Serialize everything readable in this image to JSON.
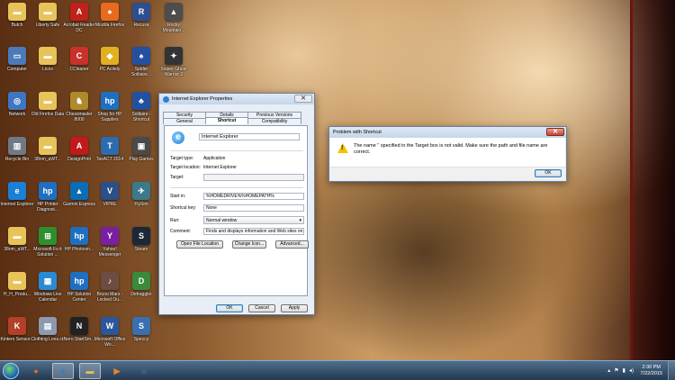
{
  "desktop_icons": [
    {
      "label": "Butch",
      "icon": "folder-icon",
      "color": "#e7c35a",
      "glyph": "▬"
    },
    {
      "label": "Liberty Safe",
      "icon": "folder-icon",
      "color": "#e7c35a",
      "glyph": "▬"
    },
    {
      "label": "Acrobat Reader DC",
      "icon": "acrobat-icon",
      "color": "#c0211b",
      "glyph": "A"
    },
    {
      "label": "Mozilla Firefox",
      "icon": "firefox-icon",
      "color": "#e86a1f",
      "glyph": "●"
    },
    {
      "label": "Recuva",
      "icon": "recuva-icon",
      "color": "#2d4f8f",
      "glyph": "R"
    },
    {
      "label": "Rocky Mountain...",
      "icon": "game-icon",
      "color": "#4d4d4d",
      "glyph": "▲"
    },
    {
      "label": "Computer",
      "icon": "computer-icon",
      "color": "#4a7bb8",
      "glyph": "▭"
    },
    {
      "label": "Licos",
      "icon": "folder-icon",
      "color": "#e7c35a",
      "glyph": "▬"
    },
    {
      "label": "CCleaner",
      "icon": "ccleaner-icon",
      "color": "#c8322a",
      "glyph": "C"
    },
    {
      "label": "PC Acitely",
      "icon": "app-icon",
      "color": "#e0b020",
      "glyph": "◆"
    },
    {
      "label": "Spider Solitaire...",
      "icon": "cards-icon",
      "color": "#2450a0",
      "glyph": "♠"
    },
    {
      "label": "Sniper Ghost Warrior 2",
      "icon": "game-icon",
      "color": "#333333",
      "glyph": "✦"
    },
    {
      "label": "Network",
      "icon": "network-icon",
      "color": "#3f76c2",
      "glyph": "◎"
    },
    {
      "label": "Old Firefox Data",
      "icon": "folder-icon",
      "color": "#e7c35a",
      "glyph": "▬"
    },
    {
      "label": "Chessmaster 8000",
      "icon": "chess-icon",
      "color": "#b08a2a",
      "glyph": "♞"
    },
    {
      "label": "Shop for HP Supplies",
      "icon": "hp-icon",
      "color": "#1f6fc1",
      "glyph": "hp"
    },
    {
      "label": "Solitaire - Shortcut",
      "icon": "cards-icon",
      "color": "#2450a0",
      "glyph": "♣"
    },
    {
      "label": "Recycle Bin",
      "icon": "recycle-bin-icon",
      "color": "#707a86",
      "glyph": "▥"
    },
    {
      "label": "38nm_aWT...",
      "icon": "folder-icon",
      "color": "#e7c35a",
      "glyph": "▬"
    },
    {
      "label": "DesignPrint",
      "icon": "avery-icon",
      "color": "#c21a1a",
      "glyph": "A"
    },
    {
      "label": "TaxACT 2014",
      "icon": "taxact-icon",
      "color": "#2b6cb0",
      "glyph": "T"
    },
    {
      "label": "Play Games",
      "icon": "games-icon",
      "color": "#4a4a4a",
      "glyph": "▣"
    },
    {
      "label": "Internet Explorer",
      "icon": "ie-icon",
      "color": "#1c7fd6",
      "glyph": "e"
    },
    {
      "label": "HP Printer Diagnost...",
      "icon": "hp-icon",
      "color": "#1f6fc1",
      "glyph": "hp"
    },
    {
      "label": "Garmin Express",
      "icon": "garmin-icon",
      "color": "#0a6db5",
      "glyph": "▲"
    },
    {
      "label": "VIPRE",
      "icon": "vipre-icon",
      "color": "#2a4f8a",
      "glyph": "V"
    },
    {
      "label": "FlySim",
      "icon": "flysim-icon",
      "color": "#3a7a8a",
      "glyph": "✈"
    },
    {
      "label": "38nm_aWT...",
      "icon": "folder-icon",
      "color": "#e7c35a",
      "glyph": "▬"
    },
    {
      "label": "Microsoft Fo it Solution ...",
      "icon": "windows-icon",
      "color": "#2f8f2f",
      "glyph": "⊞"
    },
    {
      "label": "HP Photosm...",
      "icon": "hp-icon",
      "color": "#1f6fc1",
      "glyph": "hp"
    },
    {
      "label": "Yahoo! Messenger",
      "icon": "yahoo-icon",
      "color": "#7b1fa2",
      "glyph": "Y"
    },
    {
      "label": "Steam",
      "icon": "steam-icon",
      "color": "#1b2838",
      "glyph": "S"
    },
    {
      "label": "H_H_Produ...",
      "icon": "folder-icon",
      "color": "#e7c35a",
      "glyph": "▬"
    },
    {
      "label": "Windows Live Calendar",
      "icon": "calendar-icon",
      "color": "#2b8ad6",
      "glyph": "▦"
    },
    {
      "label": "HP Solution Center",
      "icon": "hp-icon",
      "color": "#1f6fc1",
      "glyph": "hp"
    },
    {
      "label": "Bruno Mars - Locked Ou...",
      "icon": "music-icon",
      "color": "#6d4c41",
      "glyph": "♪"
    },
    {
      "label": "Defraggler",
      "icon": "defraggler-icon",
      "color": "#3a8a3a",
      "glyph": "D"
    },
    {
      "label": "Kintero Sensor...",
      "icon": "app-icon",
      "color": "#b2402a",
      "glyph": "K"
    },
    {
      "label": "Clothing Loos.cb",
      "icon": "document-icon",
      "color": "#8a9bb0",
      "glyph": "▤"
    },
    {
      "label": "Nero StartSm...",
      "icon": "nero-icon",
      "color": "#222222",
      "glyph": "N"
    },
    {
      "label": "Microsoft Office Wo...",
      "icon": "word-icon",
      "color": "#2b579a",
      "glyph": "W"
    },
    {
      "label": "Speccy",
      "icon": "speccy-icon",
      "color": "#3a6fb0",
      "glyph": "S"
    }
  ],
  "properties_window": {
    "title": "Internet Explorer Properties",
    "tabs_back": [
      "Security",
      "Details",
      "Previous Versions"
    ],
    "tabs_front": [
      "General",
      "Shortcut",
      "Compatibility"
    ],
    "active_tab": "Shortcut",
    "app_name": "Internet Explorer",
    "fields": {
      "target_type_label": "Target type:",
      "target_type_value": "Application",
      "target_location_label": "Target location:",
      "target_location_value": "Internet Explorer",
      "target_label": "Target:",
      "target_value": "",
      "start_in_label": "Start in:",
      "start_in_value": "%HOMEDRIVE%%HOMEPATH%",
      "shortcut_key_label": "Shortcut key:",
      "shortcut_key_value": "None",
      "run_label": "Run:",
      "run_value": "Normal window",
      "comment_label": "Comment:",
      "comment_value": "Finds and displays information and Web sites on th"
    },
    "buttons": {
      "open_file_location": "Open File Location",
      "change_icon": "Change Icon...",
      "advanced": "Advanced...",
      "ok": "OK",
      "cancel": "Cancel",
      "apply": "Apply"
    }
  },
  "message_box": {
    "title": "Problem with Shortcut",
    "message": "The name '' specified in the Target box is not valid. Make sure the path and file name are correct.",
    "ok": "OK"
  },
  "taskbar": {
    "pinned": [
      {
        "icon": "firefox-icon",
        "color": "#e86a1f",
        "glyph": "●",
        "active": false
      },
      {
        "icon": "ie-icon",
        "color": "#1c7fd6",
        "glyph": "e",
        "active": true
      },
      {
        "icon": "explorer-icon",
        "color": "#e7c35a",
        "glyph": "▬",
        "active": true
      },
      {
        "icon": "media-player-icon",
        "color": "#e8822a",
        "glyph": "▶",
        "active": false
      },
      {
        "icon": "app-icon",
        "color": "#3a5f8a",
        "glyph": "⊗",
        "active": false
      }
    ],
    "time": "2:30 PM",
    "date": "7/22/2015"
  }
}
